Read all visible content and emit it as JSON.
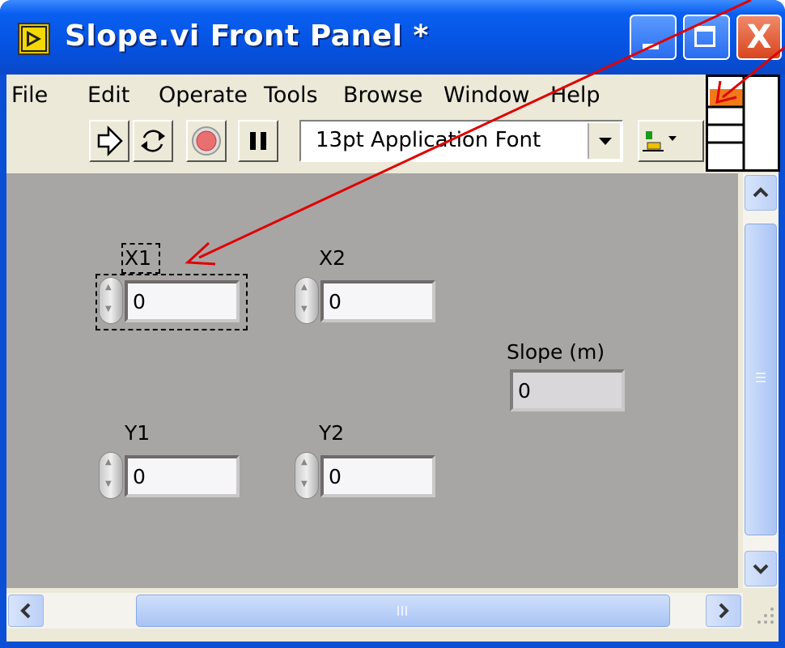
{
  "window": {
    "title": "Slope.vi Front Panel *",
    "close_glyph": "X"
  },
  "menubar": {
    "items": [
      "File",
      "Edit",
      "Operate",
      "Tools",
      "Browse",
      "Window",
      "Help"
    ]
  },
  "toolbar": {
    "run_icon": "run-arrow-icon",
    "continuous_icon": "run-continuously-icon",
    "abort_icon": "abort-stop-icon",
    "pause_icon": "pause-icon",
    "font": "13pt Application Font",
    "align_icon": "align-objects-icon"
  },
  "controls": {
    "x1": {
      "label": "X1",
      "value": "0"
    },
    "x2": {
      "label": "X2",
      "value": "0"
    },
    "y1": {
      "label": "Y1",
      "value": "0"
    },
    "y2": {
      "label": "Y2",
      "value": "0"
    }
  },
  "indicators": {
    "slope": {
      "label": "Slope (m)",
      "value": "0"
    }
  },
  "colors": {
    "titlebar": "#0553e3",
    "panel": "#a8a5a5",
    "annotation_arrow": "#e00000",
    "connector_selected": "#f07a1a"
  }
}
